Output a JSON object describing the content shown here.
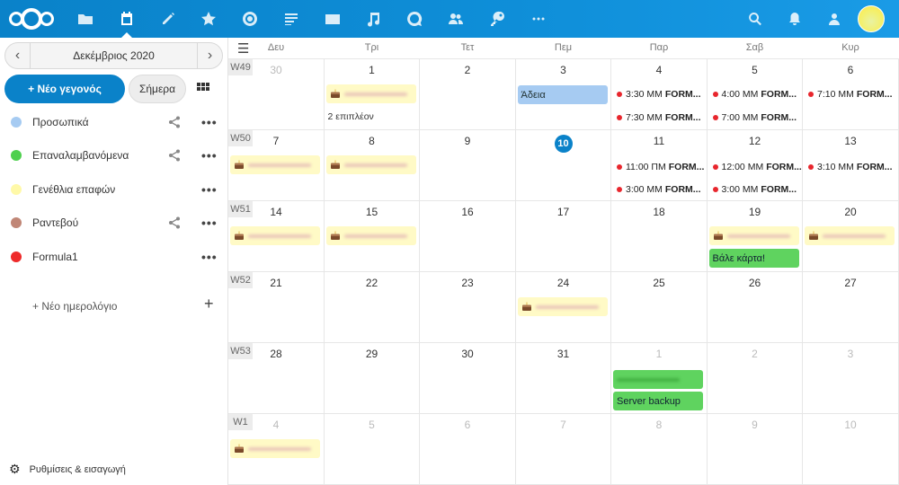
{
  "header": {
    "apps": [
      "files-icon",
      "calendar-icon",
      "notes-icon",
      "favorites-icon",
      "activity-icon",
      "news-icon",
      "mail-icon",
      "music-icon",
      "talk-icon",
      "contacts-icon",
      "passwords-icon",
      "more-apps-icon"
    ],
    "right": [
      "search-icon",
      "notifications-icon",
      "contacts-menu-icon",
      "avatar"
    ],
    "accent": "#0a82c9"
  },
  "sidebar": {
    "month": "Δεκέμβριος 2020",
    "new_event": "+ Νέο γεγονός",
    "today": "Σήμερα",
    "calendars": [
      {
        "name": "Προσωπικά",
        "color": "#a6cbf2",
        "shared": true
      },
      {
        "name": "Επαναλαμβανόμενα",
        "color": "#4fd04f",
        "shared": true
      },
      {
        "name": "Γενέθλια επαφών",
        "color": "#fff9a8",
        "shared": false
      },
      {
        "name": "Ραντεβού",
        "color": "#c08676",
        "shared": true
      },
      {
        "name": "Formula1",
        "color": "#ee2a2a",
        "shared": false
      }
    ],
    "more": "•••",
    "new_calendar": "+ Νέο ημερολόγιο",
    "settings": "Ρυθμίσεις & εισαγωγή"
  },
  "calendar": {
    "days": [
      "Δευ",
      "Τρι",
      "Τετ",
      "Πεμ",
      "Παρ",
      "Σαβ",
      "Κυρ"
    ],
    "weeks": [
      {
        "label": "W49",
        "dates": [
          "30",
          "1",
          "2",
          "3",
          "4",
          "5",
          "6"
        ],
        "other": [
          true,
          false,
          false,
          false,
          false,
          false,
          false
        ]
      },
      {
        "label": "W50",
        "dates": [
          "7",
          "8",
          "9",
          "10",
          "11",
          "12",
          "13"
        ],
        "other": [
          false,
          false,
          false,
          false,
          false,
          false,
          false
        ]
      },
      {
        "label": "W51",
        "dates": [
          "14",
          "15",
          "16",
          "17",
          "18",
          "19",
          "20"
        ],
        "other": [
          false,
          false,
          false,
          false,
          false,
          false,
          false
        ]
      },
      {
        "label": "W52",
        "dates": [
          "21",
          "22",
          "23",
          "24",
          "25",
          "26",
          "27"
        ],
        "other": [
          false,
          false,
          false,
          false,
          false,
          false,
          false
        ]
      },
      {
        "label": "W53",
        "dates": [
          "28",
          "29",
          "30",
          "31",
          "1",
          "2",
          "3"
        ],
        "other": [
          false,
          false,
          false,
          false,
          true,
          true,
          true
        ]
      },
      {
        "label": "W1",
        "dates": [
          "4",
          "5",
          "6",
          "7",
          "8",
          "9",
          "10"
        ],
        "other": [
          true,
          true,
          true,
          true,
          true,
          true,
          true
        ]
      }
    ],
    "today_index": [
      1,
      3
    ],
    "events": {
      "more_link": "2 επιπλέον",
      "leave": "Άδεια",
      "card": "Βάλε κάρτα!",
      "backup": "Server backup",
      "f1": [
        {
          "time": "3:30 ΜΜ",
          "title": "FORM..."
        },
        {
          "time": "7:30 ΜΜ",
          "title": "FORM..."
        },
        {
          "time": "4:00 ΜΜ",
          "title": "FORM..."
        },
        {
          "time": "7:00 ΜΜ",
          "title": "FORM..."
        },
        {
          "time": "7:10 ΜΜ",
          "title": "FORM..."
        },
        {
          "time": "11:00 ΠΜ",
          "title": "FORM..."
        },
        {
          "time": "3:00 ΜΜ",
          "title": "FORM..."
        },
        {
          "time": "12:00 ΜΜ",
          "title": "FORM..."
        },
        {
          "time": "3:00 ΜΜ",
          "title": "FORM..."
        },
        {
          "time": "3:10 ΜΜ",
          "title": "FORM..."
        }
      ]
    }
  }
}
